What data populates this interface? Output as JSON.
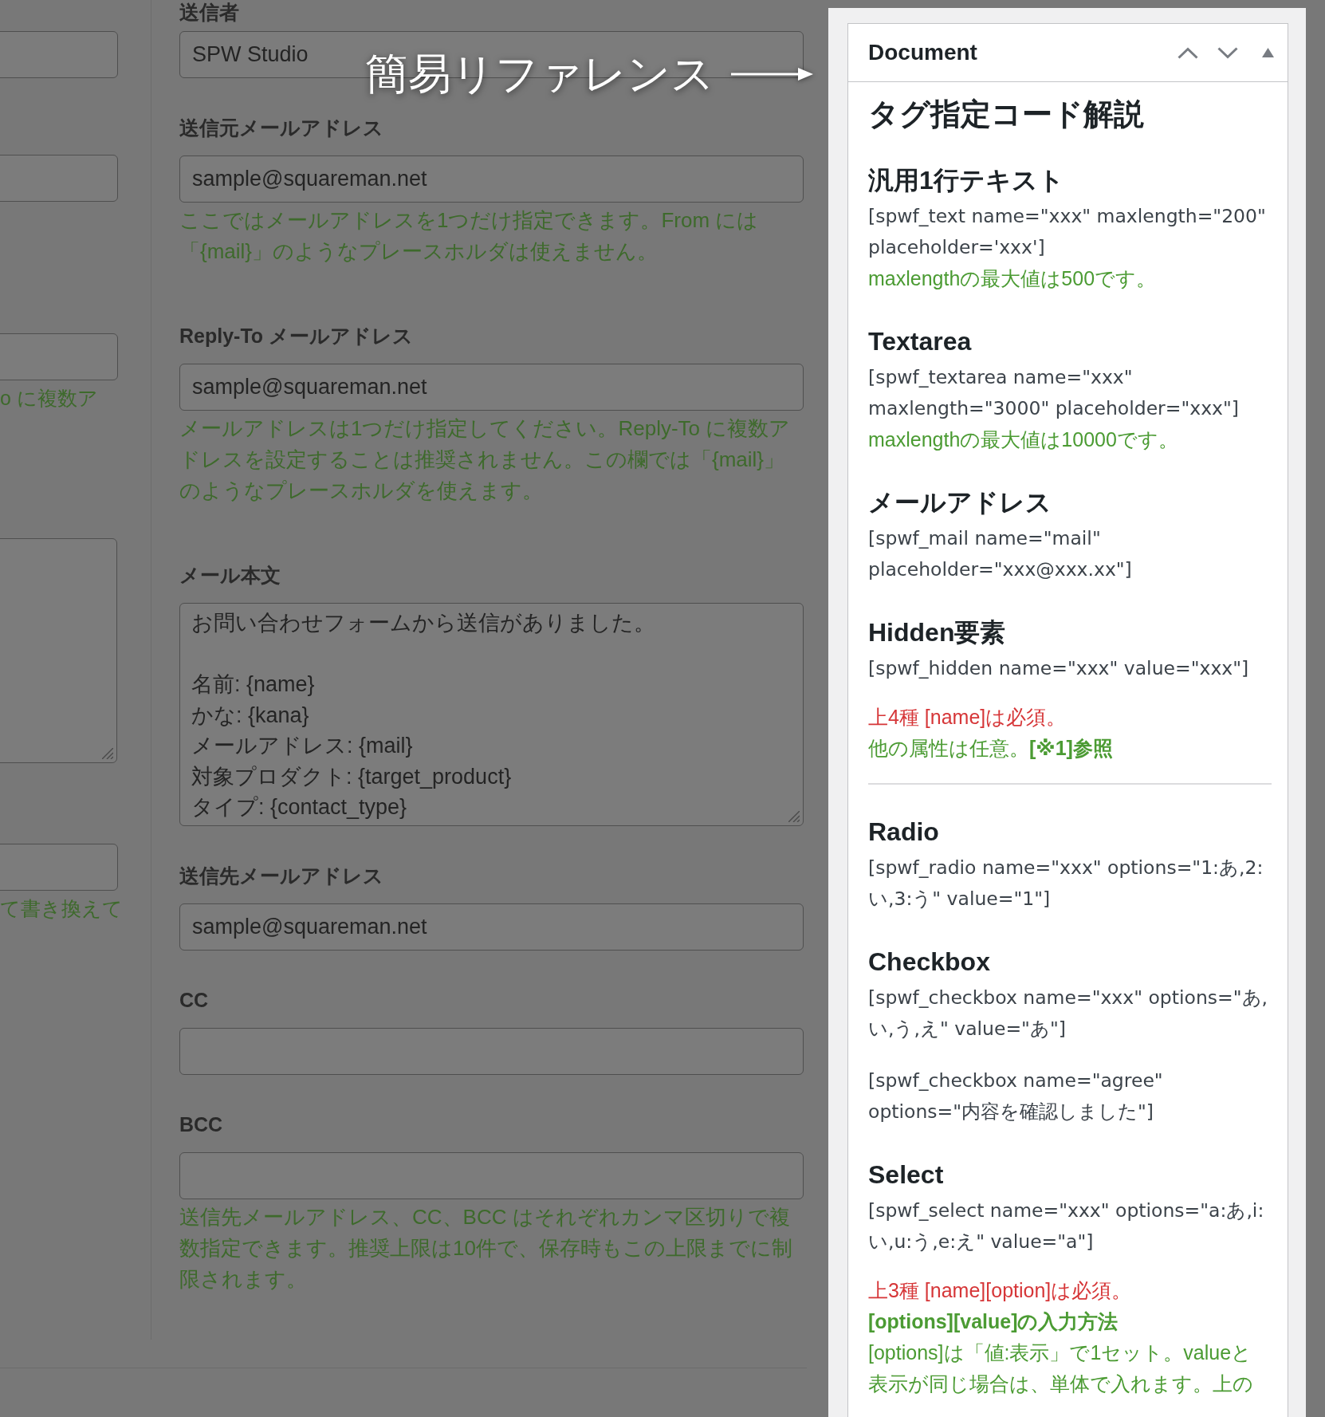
{
  "annotation": {
    "text": "簡易リファレンス"
  },
  "left_column": {
    "fields": [
      {
        "kind": "input"
      },
      {
        "kind": "input"
      },
      {
        "kind": "input",
        "help": "o に複数ア"
      },
      {
        "kind": "textarea"
      },
      {
        "kind": "input",
        "help": "て書き換えて"
      }
    ]
  },
  "form": {
    "sections": [
      {
        "label": "送信者",
        "kind": "input",
        "value": "SPW Studio"
      },
      {
        "label": "送信元メールアドレス",
        "kind": "input",
        "value": "sample@squareman.net",
        "help": "ここではメールアドレスを1つだけ指定できます。From には「{mail}」のようなプレースホルダは使えません。"
      },
      {
        "label": "Reply-To メールアドレス",
        "kind": "input",
        "value": "sample@squareman.net",
        "help": "メールアドレスは1つだけ指定してください。Reply-To に複数アドレスを設定することは推奨されません。この欄では「{mail}」のようなプレースホルダを使えます。"
      },
      {
        "label": "メール本文",
        "kind": "textarea",
        "paragraphs": [
          [
            "お問い合わせフォームから送信がありました。"
          ],
          [
            "名前: {name}",
            "かな: {kana}",
            "メールアドレス: {mail}",
            "対象プロダクト: {target_product}",
            "タイプ: {contact_type}"
          ]
        ]
      },
      {
        "label": "送信先メールアドレス",
        "kind": "input",
        "value": "sample@squareman.net"
      },
      {
        "label": "CC",
        "kind": "input"
      },
      {
        "label": "BCC",
        "kind": "input",
        "help": "送信先メールアドレス、CC、BCC はそれぞれカンマ区切りで複数指定できます。推奨上限は10件で、保存時もこの上限までに制限されます。"
      }
    ]
  },
  "document_panel": {
    "title": "Document",
    "heading": "タグ指定コード解説",
    "groups": [
      {
        "sections": [
          {
            "title": "汎用1行テキスト",
            "blocks": [
              {
                "kind": "code",
                "text": "[spwf_text name=\"xxx\" maxlength=\"200\" placeholder='xxx']"
              },
              {
                "kind": "note",
                "text": "maxlengthの最大値は500です。"
              }
            ]
          },
          {
            "title": "Textarea",
            "blocks": [
              {
                "kind": "code",
                "text": "[spwf_textarea name=\"xxx\" maxlength=\"3000\" placeholder=\"xxx\"]"
              },
              {
                "kind": "note",
                "text": "maxlengthの最大値は10000です。"
              }
            ]
          },
          {
            "title": "メールアドレス",
            "blocks": [
              {
                "kind": "code",
                "text": "[spwf_mail name=\"mail\" placeholder=\"xxx@xxx.xx\"]"
              }
            ]
          },
          {
            "title": "Hidden要素",
            "blocks": [
              {
                "kind": "code",
                "text": "[spwf_hidden name=\"xxx\" value=\"xxx\"]"
              },
              {
                "kind": "required",
                "text": "上4種 [name]は必須。"
              },
              {
                "kind": "note",
                "text": "他の属性は任意。**[※1]参照**"
              }
            ]
          }
        ]
      },
      {
        "sections": [
          {
            "title": "Radio",
            "blocks": [
              {
                "kind": "code",
                "text": "[spwf_radio name=\"xxx\" options=\"1:あ,2:い,3:う\" value=\"1\"]"
              }
            ]
          },
          {
            "title": "Checkbox",
            "blocks": [
              {
                "kind": "code",
                "text": "[spwf_checkbox name=\"xxx\" options=\"あ,い,う,え\" value=\"あ\"]"
              },
              {
                "kind": "code",
                "text": "[spwf_checkbox name=\"agree\" options=\"内容を確認しました\"]"
              }
            ]
          },
          {
            "title": "Select",
            "blocks": [
              {
                "kind": "code",
                "text": "[spwf_select name=\"xxx\" options=\"a:あ,i:い,u:う,e:え\" value=\"a\"]"
              },
              {
                "kind": "required",
                "text": "上3種 [name][option]は必須。"
              },
              {
                "kind": "note_heading",
                "text": "[options][value]の入力方法"
              },
              {
                "kind": "note",
                "text": "[options]は「値:表示」で1セット。valueと表示が同じ場合は、単体で入れます。上の"
              }
            ]
          }
        ]
      }
    ]
  }
}
